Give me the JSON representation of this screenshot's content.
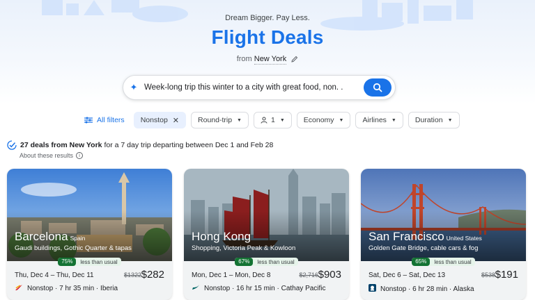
{
  "header": {
    "tagline": "Dream Bigger. Pay Less.",
    "title": "Flight Deals",
    "from_prefix": "from",
    "from_city": "New York"
  },
  "search": {
    "query": "Week-long trip this winter to a city with great food, non. ."
  },
  "filters": {
    "all_filters": "All filters",
    "nonstop": "Nonstop",
    "trip_type": "Round-trip",
    "passengers": "1",
    "cabin": "Economy",
    "airlines": "Airlines",
    "duration": "Duration"
  },
  "summary": {
    "count_text": "27 deals from New York",
    "rest_text": "for a 7 day trip departing between Dec 1 and Feb 28",
    "about": "About these results"
  },
  "deals": [
    {
      "city": "Barcelona",
      "country": "Spain",
      "description": "Gaudi buildings, Gothic Quarter & tapas",
      "badge_pct": "75%",
      "badge_label": "less than usual",
      "dates": "Thu, Dec 4 – Thu, Dec 11",
      "old_price": "$1322",
      "price": "$282",
      "flight": "Nonstop · 7 hr 35 min · Iberia",
      "airline_color": "#d7192d"
    },
    {
      "city": "Hong Kong",
      "country": "",
      "description": "Shopping, Victoria Peak & Kowloon",
      "badge_pct": "67%",
      "badge_label": "less than usual",
      "dates": "Mon, Dec 1 – Mon, Dec 8",
      "old_price": "$2,716",
      "price": "$903",
      "flight": "Nonstop · 16 hr 15 min · Cathay Pacific",
      "airline_color": "#006564"
    },
    {
      "city": "San Francisco",
      "country": "United States",
      "description": "Golden Gate Bridge, cable cars & fog",
      "badge_pct": "65%",
      "badge_label": "less than usual",
      "dates": "Sat, Dec 6 – Sat, Dec 13",
      "old_price": "$538",
      "price": "$191",
      "flight": "Nonstop · 6 hr 28 min · Alaska",
      "airline_color": "#01426a"
    }
  ],
  "colors": {
    "accent": "#1a73e8",
    "badge_green": "#137333"
  }
}
